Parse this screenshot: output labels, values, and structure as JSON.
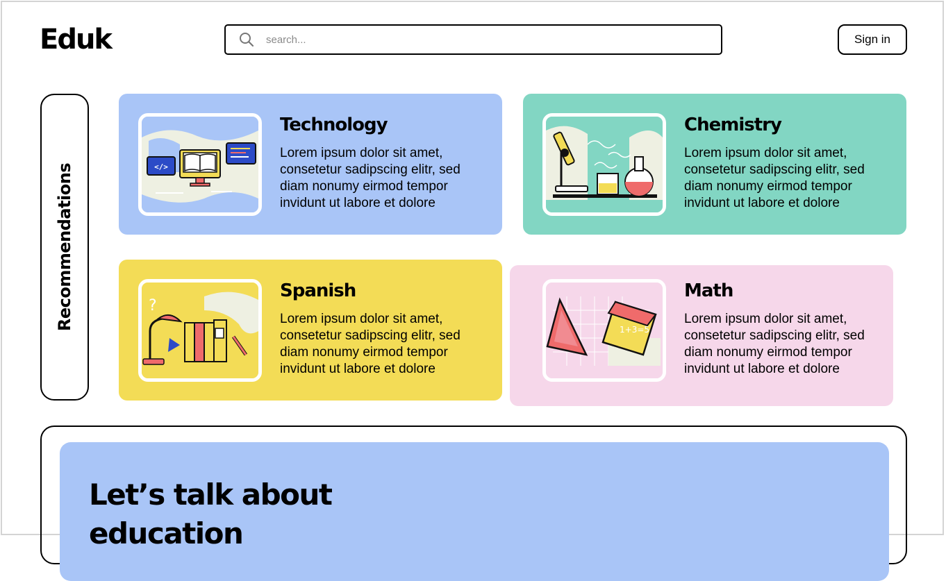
{
  "header": {
    "logo": "Eduk",
    "search_placeholder": "search...",
    "signin_label": "Sign in"
  },
  "recommendations": {
    "label": "Recommendations",
    "cards": [
      {
        "title": "Technology",
        "text": "Lorem ipsum dolor sit amet, consetetur sadipscing elitr, sed diam nonumy eirmod tempor invidunt ut labore et dolore",
        "color": "#a9c5f7"
      },
      {
        "title": "Chemistry",
        "text": "Lorem ipsum dolor sit amet, consetetur sadipscing elitr, sed diam nonumy eirmod tempor invidunt ut labore et dolore",
        "color": "#82d6c3"
      },
      {
        "title": "Spanish",
        "text": "Lorem ipsum dolor sit amet, consetetur sadipscing elitr, sed diam nonumy eirmod tempor invidunt ut labore et dolore",
        "color": "#f3dc56"
      },
      {
        "title": "Math",
        "text": "Lorem ipsum dolor sit amet, consetetur sadipscing elitr, sed diam nonumy eirmod tempor invidunt ut labore et dolore",
        "color": "#f6d7ea"
      }
    ]
  },
  "talk": {
    "heading": "Let’s talk about education"
  },
  "icons": {
    "search": "search-icon",
    "technology": "technology-illustration-icon",
    "chemistry": "chemistry-illustration-icon",
    "spanish": "spanish-illustration-icon",
    "math": "math-illustration-icon"
  }
}
